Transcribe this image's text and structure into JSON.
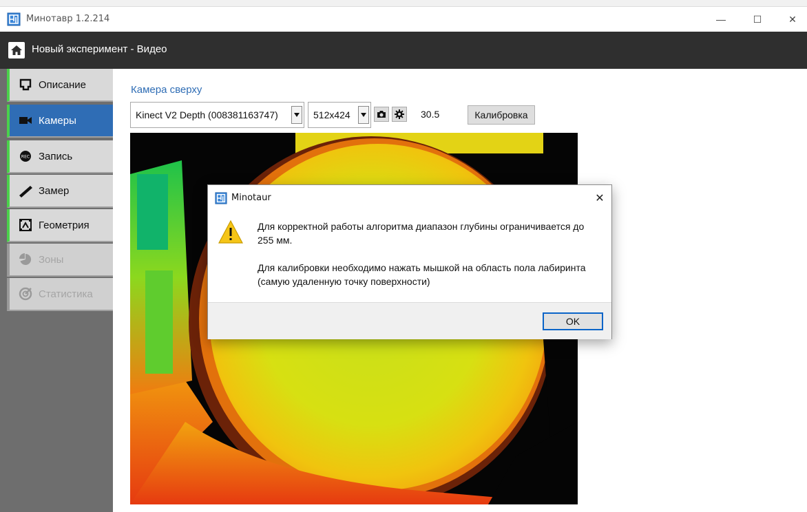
{
  "window": {
    "title": "Минотавр 1.2.214",
    "controls": {
      "minimize": "—",
      "maximize": "☐",
      "close": "✕"
    }
  },
  "header": {
    "title": "Новый эксперимент - Видео"
  },
  "sidebar": {
    "items": [
      {
        "label": "Описание",
        "icon": "tablet-icon",
        "state": "normal"
      },
      {
        "label": "Камеры",
        "icon": "video-camera-icon",
        "state": "active"
      },
      {
        "label": "Запись",
        "icon": "record-icon",
        "state": "normal"
      },
      {
        "label": "Замер",
        "icon": "ruler-icon",
        "state": "normal"
      },
      {
        "label": "Геометрия",
        "icon": "geometry-icon",
        "state": "normal"
      },
      {
        "label": "Зоны",
        "icon": "pie-chart-icon",
        "state": "disabled"
      },
      {
        "label": "Статистика",
        "icon": "stats-icon",
        "state": "disabled"
      }
    ]
  },
  "main": {
    "camera_title": "Камера сверху",
    "camera_select": "Kinect V2 Depth (008381163747)",
    "resolution_select": "512x424",
    "fps": "30.5",
    "calibrate_label": "Калибровка"
  },
  "dialog": {
    "title": "Minotaur",
    "close": "✕",
    "message_line1": "Для корректной работы алгоритма диапазон глубины ограничивается до 255 мм.",
    "message_line2": "Для калибровки необходимо нажать мышкой на область пола лабиринта (самую удаленную точку поверхности)",
    "ok_label": "OK"
  },
  "colors": {
    "accent": "#2f6db5",
    "header_bg": "#2f2f2f",
    "sidebar_bg": "#6e6e6e",
    "nav_indicator": "#4bd14b",
    "warning": "#f5c518"
  }
}
